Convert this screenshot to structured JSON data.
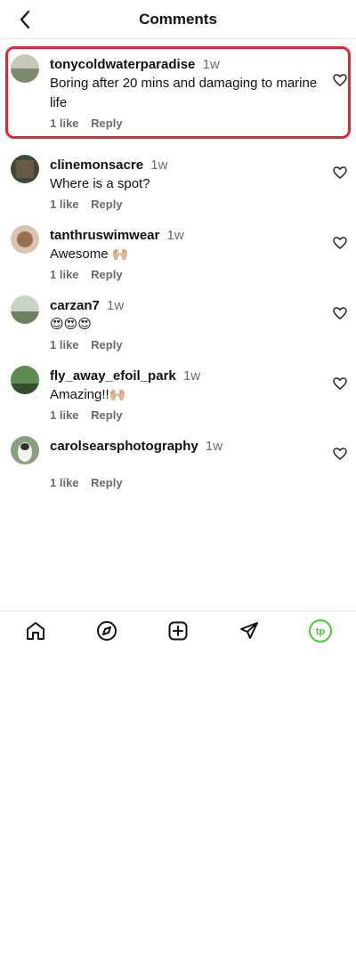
{
  "header": {
    "title": "Comments"
  },
  "comments": [
    {
      "username": "tonycoldwaterparadise",
      "time": "1w",
      "text": "Boring after 20 mins and damaging to marine life",
      "likes": "1 like",
      "reply": "Reply",
      "avatar_color": "#9aa48a",
      "highlight_color": "#e0243a"
    },
    {
      "username": "clinemonsacre",
      "time": "1w",
      "text": "Where is a spot?",
      "likes": "1 like",
      "reply": "Reply",
      "avatar_color": "#4e5a42"
    },
    {
      "username": "tanthruswimwear",
      "time": "1w",
      "text": "Awesome 🙌🏼",
      "likes": "1 like",
      "reply": "Reply",
      "avatar_color": "#a87a5a"
    },
    {
      "username": "carzan7",
      "time": "1w",
      "text": "😍😍😍",
      "likes": "1 like",
      "reply": "Reply",
      "avatar_color": "#7a8a75"
    },
    {
      "username": "fly_away_efoil_park",
      "time": "1w",
      "text": "Amazing!!🙌🏼",
      "likes": "1 like",
      "reply": "Reply",
      "avatar_color": "#5a8b4f"
    },
    {
      "username": "carolsearsphotography",
      "time": "1w",
      "text": "",
      "likes": "1 like",
      "reply": "Reply",
      "avatar_color": "#6a7c63"
    }
  ],
  "nav": {
    "items": [
      "home-icon",
      "compass-icon",
      "create-icon",
      "send-icon",
      "profile-avatar"
    ]
  },
  "colors": {
    "accent": "#e0243a",
    "profile_ring": "#48c832"
  }
}
